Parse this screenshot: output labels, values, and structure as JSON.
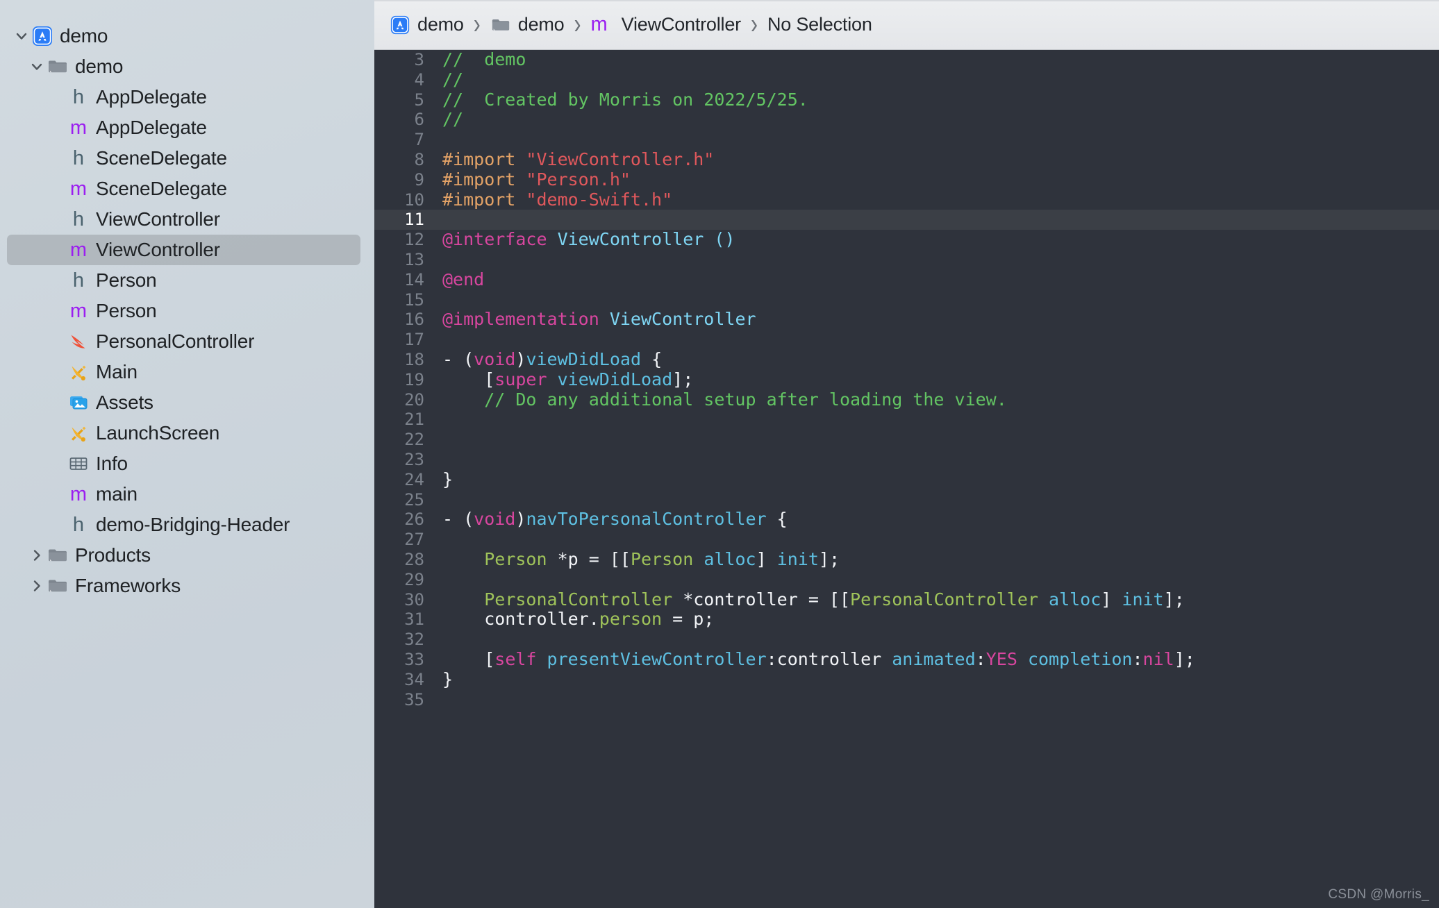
{
  "sidebar": {
    "items": [
      {
        "label": "demo",
        "icon": "app-icon",
        "indent": 0,
        "twisty": "down",
        "selected": false
      },
      {
        "label": "demo",
        "icon": "folder-icon",
        "indent": 1,
        "twisty": "down",
        "selected": false
      },
      {
        "label": "AppDelegate",
        "icon": "header-file-icon",
        "indent": 2,
        "twisty": "none",
        "selected": false
      },
      {
        "label": "AppDelegate",
        "icon": "objc-file-icon",
        "indent": 2,
        "twisty": "none",
        "selected": false
      },
      {
        "label": "SceneDelegate",
        "icon": "header-file-icon",
        "indent": 2,
        "twisty": "none",
        "selected": false
      },
      {
        "label": "SceneDelegate",
        "icon": "objc-file-icon",
        "indent": 2,
        "twisty": "none",
        "selected": false
      },
      {
        "label": "ViewController",
        "icon": "header-file-icon",
        "indent": 2,
        "twisty": "none",
        "selected": false
      },
      {
        "label": "ViewController",
        "icon": "objc-file-icon",
        "indent": 2,
        "twisty": "none",
        "selected": true
      },
      {
        "label": "Person",
        "icon": "header-file-icon",
        "indent": 2,
        "twisty": "none",
        "selected": false
      },
      {
        "label": "Person",
        "icon": "objc-file-icon",
        "indent": 2,
        "twisty": "none",
        "selected": false
      },
      {
        "label": "PersonalController",
        "icon": "swift-file-icon",
        "indent": 2,
        "twisty": "none",
        "selected": false
      },
      {
        "label": "Main",
        "icon": "storyboard-icon",
        "indent": 2,
        "twisty": "none",
        "selected": false
      },
      {
        "label": "Assets",
        "icon": "assets-catalog-icon",
        "indent": 2,
        "twisty": "none",
        "selected": false
      },
      {
        "label": "LaunchScreen",
        "icon": "storyboard-icon",
        "indent": 2,
        "twisty": "none",
        "selected": false
      },
      {
        "label": "Info",
        "icon": "plist-icon",
        "indent": 2,
        "twisty": "none",
        "selected": false
      },
      {
        "label": "main",
        "icon": "objc-file-icon",
        "indent": 2,
        "twisty": "none",
        "selected": false
      },
      {
        "label": "demo-Bridging-Header",
        "icon": "header-file-icon",
        "indent": 2,
        "twisty": "none",
        "selected": false
      },
      {
        "label": "Products",
        "icon": "folder-icon",
        "indent": 1,
        "twisty": "right",
        "selected": false
      },
      {
        "label": "Frameworks",
        "icon": "folder-icon",
        "indent": 1,
        "twisty": "right",
        "selected": false
      }
    ]
  },
  "jump_bar": {
    "crumbs": [
      {
        "label": "demo",
        "icon": "app-icon"
      },
      {
        "label": "demo",
        "icon": "folder-icon"
      },
      {
        "label": "ViewController",
        "icon": "objc-file-icon"
      },
      {
        "label": "No Selection",
        "icon": "none"
      }
    ],
    "separator": "›"
  },
  "editor": {
    "current_line": 11,
    "lines": [
      {
        "n": 3,
        "tokens": [
          {
            "c": "t-com",
            "t": "//  demo"
          }
        ]
      },
      {
        "n": 4,
        "tokens": [
          {
            "c": "t-com",
            "t": "//"
          }
        ]
      },
      {
        "n": 5,
        "tokens": [
          {
            "c": "t-com",
            "t": "//  Created by Morris on 2022/5/25."
          }
        ]
      },
      {
        "n": 6,
        "tokens": [
          {
            "c": "t-com",
            "t": "//"
          }
        ]
      },
      {
        "n": 7,
        "tokens": []
      },
      {
        "n": 8,
        "tokens": [
          {
            "c": "t-pre",
            "t": "#import "
          },
          {
            "c": "t-str",
            "t": "\"ViewController.h\""
          }
        ]
      },
      {
        "n": 9,
        "tokens": [
          {
            "c": "t-pre",
            "t": "#import "
          },
          {
            "c": "t-str",
            "t": "\"Person.h\""
          }
        ]
      },
      {
        "n": 10,
        "tokens": [
          {
            "c": "t-pre",
            "t": "#import "
          },
          {
            "c": "t-str",
            "t": "\"demo-Swift.h\""
          }
        ]
      },
      {
        "n": 11,
        "tokens": []
      },
      {
        "n": 12,
        "tokens": [
          {
            "c": "t-kw",
            "t": "@interface "
          },
          {
            "c": "t-type",
            "t": "ViewController ()"
          }
        ]
      },
      {
        "n": 13,
        "tokens": []
      },
      {
        "n": 14,
        "tokens": [
          {
            "c": "t-kw",
            "t": "@end"
          }
        ]
      },
      {
        "n": 15,
        "tokens": []
      },
      {
        "n": 16,
        "tokens": [
          {
            "c": "t-kw",
            "t": "@implementation "
          },
          {
            "c": "t-type",
            "t": "ViewController"
          }
        ]
      },
      {
        "n": 17,
        "tokens": []
      },
      {
        "n": 18,
        "tokens": [
          {
            "c": "t-pln",
            "t": "- ("
          },
          {
            "c": "t-kw",
            "t": "void"
          },
          {
            "c": "t-pln",
            "t": ")"
          },
          {
            "c": "t-mth",
            "t": "viewDidLoad"
          },
          {
            "c": "t-pln",
            "t": " {"
          }
        ]
      },
      {
        "n": 19,
        "tokens": [
          {
            "c": "t-pln",
            "t": "    ["
          },
          {
            "c": "t-kw",
            "t": "super"
          },
          {
            "c": "t-pln",
            "t": " "
          },
          {
            "c": "t-mth",
            "t": "viewDidLoad"
          },
          {
            "c": "t-pln",
            "t": "];"
          }
        ]
      },
      {
        "n": 20,
        "tokens": [
          {
            "c": "t-com",
            "t": "    // Do any additional setup after loading the view."
          }
        ]
      },
      {
        "n": 21,
        "tokens": []
      },
      {
        "n": 22,
        "tokens": []
      },
      {
        "n": 23,
        "tokens": []
      },
      {
        "n": 24,
        "tokens": [
          {
            "c": "t-pln",
            "t": "}"
          }
        ]
      },
      {
        "n": 25,
        "tokens": []
      },
      {
        "n": 26,
        "tokens": [
          {
            "c": "t-pln",
            "t": "- ("
          },
          {
            "c": "t-kw",
            "t": "void"
          },
          {
            "c": "t-pln",
            "t": ")"
          },
          {
            "c": "t-mth",
            "t": "navToPersonalController"
          },
          {
            "c": "t-pln",
            "t": " {"
          }
        ]
      },
      {
        "n": 27,
        "tokens": []
      },
      {
        "n": 28,
        "tokens": [
          {
            "c": "t-pln",
            "t": "    "
          },
          {
            "c": "t-cls",
            "t": "Person"
          },
          {
            "c": "t-pln",
            "t": " *p = [["
          },
          {
            "c": "t-cls",
            "t": "Person"
          },
          {
            "c": "t-pln",
            "t": " "
          },
          {
            "c": "t-mth",
            "t": "alloc"
          },
          {
            "c": "t-pln",
            "t": "] "
          },
          {
            "c": "t-mth",
            "t": "init"
          },
          {
            "c": "t-pln",
            "t": "];"
          }
        ]
      },
      {
        "n": 29,
        "tokens": []
      },
      {
        "n": 30,
        "tokens": [
          {
            "c": "t-pln",
            "t": "    "
          },
          {
            "c": "t-cls",
            "t": "PersonalController"
          },
          {
            "c": "t-pln",
            "t": " *controller = [["
          },
          {
            "c": "t-cls",
            "t": "PersonalController"
          },
          {
            "c": "t-pln",
            "t": " "
          },
          {
            "c": "t-mth",
            "t": "alloc"
          },
          {
            "c": "t-pln",
            "t": "] "
          },
          {
            "c": "t-mth",
            "t": "init"
          },
          {
            "c": "t-pln",
            "t": "];"
          }
        ]
      },
      {
        "n": 31,
        "tokens": [
          {
            "c": "t-pln",
            "t": "    controller."
          },
          {
            "c": "t-cls",
            "t": "person"
          },
          {
            "c": "t-pln",
            "t": " = p;"
          }
        ]
      },
      {
        "n": 32,
        "tokens": []
      },
      {
        "n": 33,
        "tokens": [
          {
            "c": "t-pln",
            "t": "    ["
          },
          {
            "c": "t-kw",
            "t": "self"
          },
          {
            "c": "t-pln",
            "t": " "
          },
          {
            "c": "t-mth",
            "t": "presentViewController"
          },
          {
            "c": "t-pln",
            "t": ":controller "
          },
          {
            "c": "t-mth",
            "t": "animated"
          },
          {
            "c": "t-pln",
            "t": ":"
          },
          {
            "c": "t-kw",
            "t": "YES"
          },
          {
            "c": "t-pln",
            "t": " "
          },
          {
            "c": "t-mth",
            "t": "completion"
          },
          {
            "c": "t-pln",
            "t": ":"
          },
          {
            "c": "t-kw",
            "t": "nil"
          },
          {
            "c": "t-pln",
            "t": "];"
          }
        ]
      },
      {
        "n": 34,
        "tokens": [
          {
            "c": "t-pln",
            "t": "}"
          }
        ]
      },
      {
        "n": 35,
        "tokens": []
      }
    ]
  },
  "watermark": {
    "text": "CSDN @Morris_"
  },
  "colors": {
    "comment": "#63c563",
    "preprocessor": "#e3a266",
    "string": "#e0585c",
    "keyword": "#d8469f",
    "type": "#7fd6f4",
    "class": "#9fc35a",
    "method": "#5ec0e2",
    "plain": "#f2f4f7",
    "editor_bg": "#2f333c",
    "current_line_bg": "#3b3f46",
    "sidebar_bg": "#ccd4db",
    "selection_bg": "#b9c0c6"
  }
}
